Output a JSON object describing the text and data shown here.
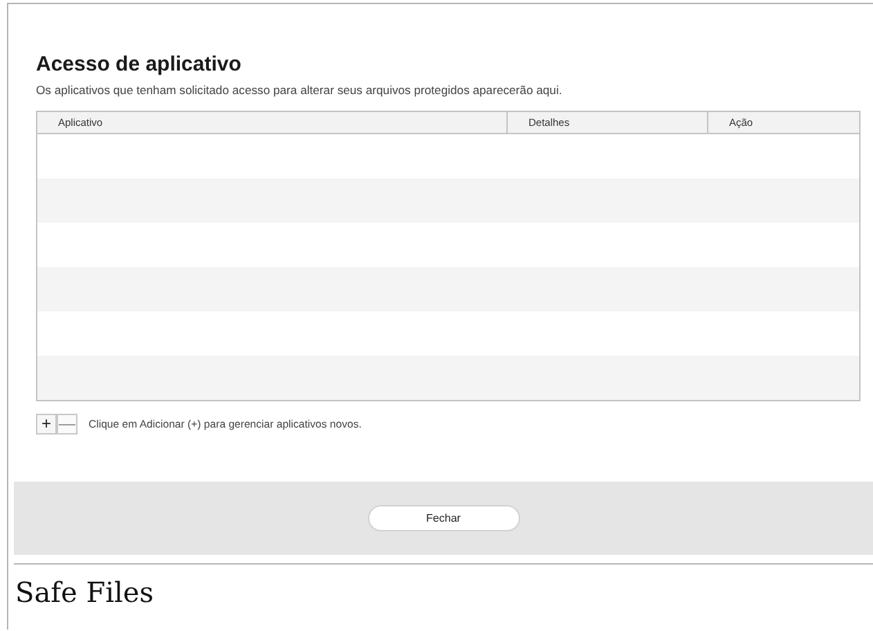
{
  "dialog": {
    "title": "Acesso de aplicativo",
    "description": "Os aplicativos que tenham solicitado acesso para alterar seus arquivos protegidos aparecerão aqui.",
    "table": {
      "columns": [
        "Aplicativo",
        "Detalhes",
        "Ação"
      ]
    },
    "add_button": {
      "label": "+",
      "disabled": false
    },
    "remove_button": {
      "label": "—",
      "disabled": true
    },
    "hint": "Clique em Adicionar (+) para gerenciar aplicativos novos.",
    "close_button": "Fechar"
  },
  "caption": "Safe Files"
}
